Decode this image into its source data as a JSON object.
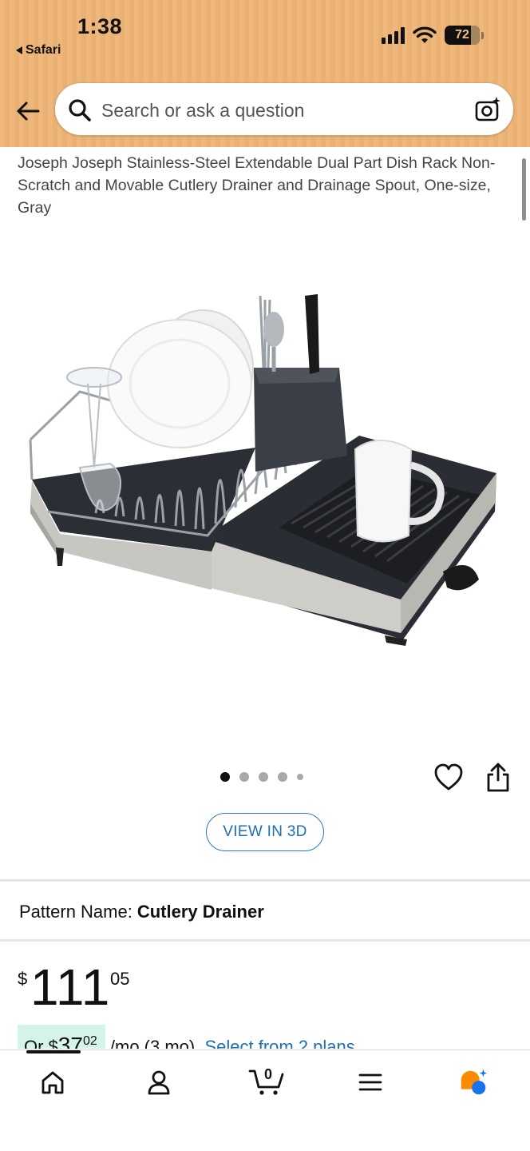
{
  "status_bar": {
    "time": "1:38",
    "back_app": "Safari",
    "battery": "72"
  },
  "search": {
    "placeholder": "Search or ask a question",
    "value": ""
  },
  "product": {
    "title": "Joseph Joseph Stainless-Steel Extendable Dual Part Dish Rack Non-Scratch and Movable Cutlery Drainer and Drainage Spout, One-size, Gray",
    "image_alt": "Dish rack with plates, wine glass, cutlery and mug",
    "carousel": {
      "total": 5,
      "active_index": 0
    },
    "view_3d_label": "VIEW IN 3D"
  },
  "pattern": {
    "label": "Pattern Name:",
    "value": "Cutlery Drainer"
  },
  "price": {
    "symbol": "$",
    "whole": "111",
    "fraction": "05"
  },
  "installment": {
    "prefix": "Or $",
    "amount_whole": "37",
    "amount_fraction": "02",
    "term": "/mo (3 mo).",
    "link_text": "Select from 2 plans"
  },
  "bottom_nav": {
    "items": [
      "home-icon",
      "account-icon",
      "cart-icon",
      "menu-icon",
      "rufus-icon"
    ],
    "cart_count": "0"
  },
  "colors": {
    "header": "#efb77a",
    "link": "#1e6fb0",
    "installment_highlight": "#d4f3ea",
    "rufus_orange": "#ff8a00",
    "rufus_blue": "#1a73e8"
  }
}
